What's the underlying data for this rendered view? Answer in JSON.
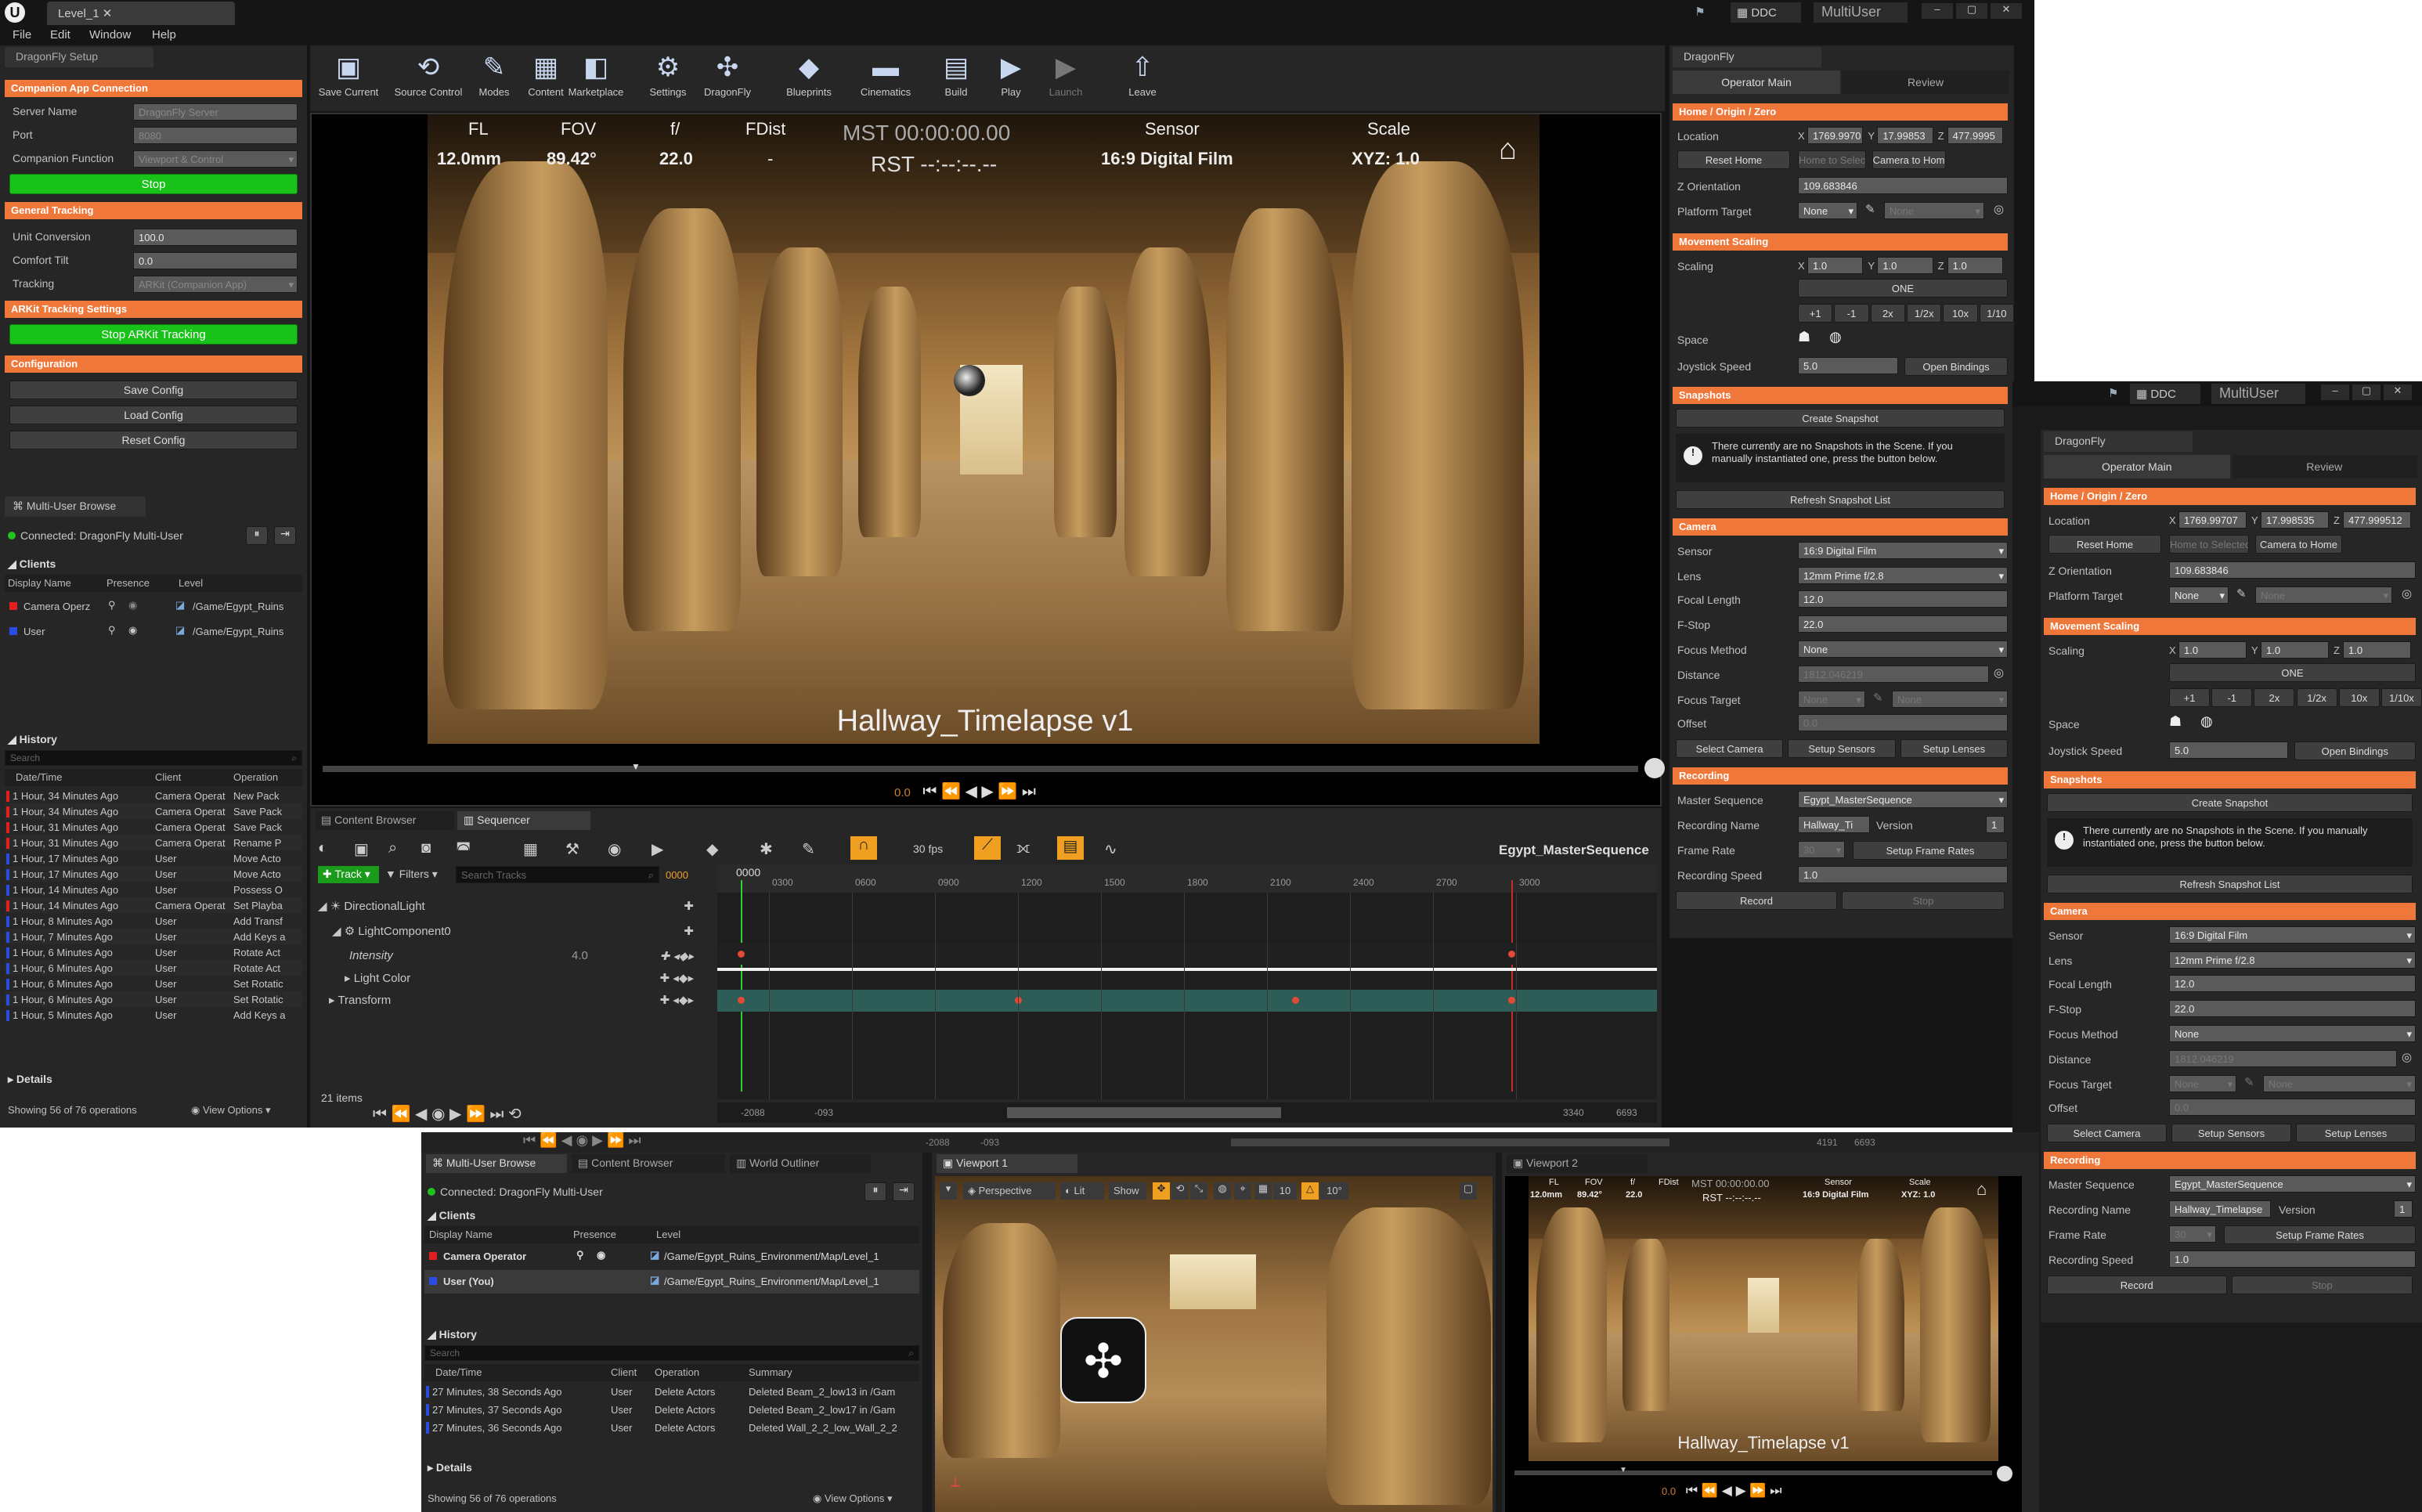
{
  "app": {
    "level_tab": "Level_1",
    "ddc": "DDC",
    "multiuser": "MultiUser",
    "menu": [
      "File",
      "Edit",
      "Window",
      "Help"
    ]
  },
  "left": {
    "tab": "DragonFly Setup",
    "s1": "Companion App Connection",
    "server_name": "Server Name",
    "server_ph": "DragonFly Server",
    "port": "Port",
    "port_val": "8080",
    "cf": "Companion Function",
    "cf_val": "Viewport & Control",
    "stop": "Stop",
    "s2": "General Tracking",
    "uc": "Unit Conversion",
    "uc_val": "100.0",
    "ct": "Comfort Tilt",
    "ct_val": "0.0",
    "tr": "Tracking",
    "tr_val": "ARKit (Companion App)",
    "s3": "ARKit Tracking Settings",
    "stop_arkit": "Stop ARKit Tracking",
    "s4": "Configuration",
    "save": "Save Config",
    "load": "Load Config",
    "reset": "Reset Config"
  },
  "mu": {
    "tab": "Multi-User Browse",
    "connected": "Connected: DragonFly Multi-User",
    "clients": "Clients",
    "cols": [
      "Display Name",
      "Presence",
      "Level"
    ],
    "rows": [
      {
        "name": "Camera Operz",
        "level": "/Game/Egypt_Ruins"
      },
      {
        "name": "User",
        "level": "/Game/Egypt_Ruins"
      }
    ],
    "history": "History",
    "search": "Search",
    "hcols": [
      "Date/Time",
      "Client",
      "Operation"
    ],
    "hrows": [
      [
        "1 Hour, 34 Minutes Ago",
        "Camera Operat",
        "New Pack"
      ],
      [
        "1 Hour, 34 Minutes Ago",
        "Camera Operat",
        "Save Pack"
      ],
      [
        "1 Hour, 31 Minutes Ago",
        "Camera Operat",
        "Save Pack"
      ],
      [
        "1 Hour, 31 Minutes Ago",
        "Camera Operat",
        "Rename P"
      ],
      [
        "1 Hour, 17 Minutes Ago",
        "User",
        "Move Acto"
      ],
      [
        "1 Hour, 17 Minutes Ago",
        "User",
        "Move Acto"
      ],
      [
        "1 Hour, 14 Minutes Ago",
        "User",
        "Possess O"
      ],
      [
        "1 Hour, 14 Minutes Ago",
        "Camera Operat",
        "Set Playba"
      ],
      [
        "1 Hour, 8 Minutes Ago",
        "User",
        "Add Transf"
      ],
      [
        "1 Hour, 7 Minutes Ago",
        "User",
        "Add Keys a"
      ],
      [
        "1 Hour, 6 Minutes Ago",
        "User",
        "Rotate Act"
      ],
      [
        "1 Hour, 6 Minutes Ago",
        "User",
        "Rotate Act"
      ],
      [
        "1 Hour, 6 Minutes Ago",
        "User",
        "Set Rotatic"
      ],
      [
        "1 Hour, 6 Minutes Ago",
        "User",
        "Set Rotatic"
      ],
      [
        "1 Hour, 5 Minutes Ago",
        "User",
        "Add Keys a"
      ]
    ],
    "details": "Details",
    "showing": "Showing 56 of 76 operations",
    "view_options": "View Options"
  },
  "toolbar": [
    "Save Current",
    "Source Control",
    "Modes",
    "Content",
    "Marketplace",
    "Settings",
    "DragonFly",
    "Blueprints",
    "Cinematics",
    "Build",
    "Play",
    "Launch",
    "Leave"
  ],
  "hud": {
    "fl": "FL",
    "fl_v": "12.0mm",
    "fov": "FOV",
    "fov_v": "89.42°",
    "f": "f/",
    "f_v": "22.0",
    "fd": "FDist",
    "fd_v": "-",
    "mst": "MST 00:00:00.00",
    "rst": "RST --:--:--.--",
    "sensor": "Sensor",
    "sensor_v": "16:9 Digital Film",
    "scale": "Scale",
    "scale_v": "XYZ: 1.0",
    "title": "Hallway_Timelapse v1",
    "time": "0.0"
  },
  "seq": {
    "tabs": [
      "Content Browser",
      "Sequencer"
    ],
    "fps": "30 fps",
    "seqname": "Egypt_MasterSequence",
    "track": "Track",
    "filters": "Filters",
    "search": "Search Tracks",
    "frame": "0000",
    "cur": "0000",
    "tracks": [
      "DirectionalLight",
      "LightComponent0",
      "Intensity",
      "Light Color",
      "Transform"
    ],
    "int_val": "4.0",
    "items": "21 items",
    "ticks": [
      "0300",
      "0600",
      "0900",
      "1200",
      "1500",
      "1800",
      "2100",
      "2400",
      "2700",
      "3000"
    ],
    "range": [
      "-2088",
      "-093",
      "3340",
      "6693"
    ]
  },
  "rp": {
    "tab": "DragonFly",
    "t1": "Operator Main",
    "t2": "Review",
    "home": "Home / Origin / Zero",
    "loc": "Location",
    "lx": "1769.9970",
    "ly": "17.99853",
    "lz": "477.9995",
    "reset_home": "Reset Home",
    "home_sel": "Home to Selected",
    "cam_home": "Camera to Home",
    "zo": "Z Orientation",
    "zo_v": "109.683846",
    "pt": "Platform Target",
    "none": "None",
    "ms": "Movement Scaling",
    "scaling": "Scaling",
    "sx": "1.0",
    "one": "ONE",
    "steps": [
      "+1",
      "-1",
      "2x",
      "1/2x",
      "10x",
      "1/10"
    ],
    "space": "Space",
    "js": "Joystick Speed",
    "js_v": "5.0",
    "bind": "Open Bindings",
    "snap": "Snapshots",
    "create": "Create Snapshot",
    "msg": "There currently are no Snapshots in the Scene. If you manually instantiated one, press the button below.",
    "refresh": "Refresh Snapshot List",
    "cam": "Camera",
    "sensor": "Sensor",
    "sensor_v": "16:9 Digital Film",
    "lens": "Lens",
    "lens_v": "12mm Prime f/2.8",
    "flen": "Focal Length",
    "flen_v": "12.0",
    "fstop": "F-Stop",
    "fstop_v": "22.0",
    "fm": "Focus Method",
    "dist": "Distance",
    "dist_v": "1812.046219",
    "ft": "Focus Target",
    "off": "Offset",
    "off_v": "0.0",
    "selcam": "Select Camera",
    "setsens": "Setup Sensors",
    "setlens": "Setup Lenses",
    "rec": "Recording",
    "ms2": "Master Sequence",
    "ms2_v": "Egypt_MasterSequence",
    "rn": "Recording Name",
    "rn_v": "Hallway_Ti",
    "rn_v2": "Hallway_Timelapse",
    "ver": "Version",
    "ver_v": "1",
    "fr": "Frame Rate",
    "fr_v": "30",
    "sfr": "Setup Frame Rates",
    "rs": "Recording Speed",
    "rs_v": "1.0",
    "record": "Record",
    "stop": "Stop"
  },
  "rp2": {
    "lx": "1769.99707",
    "ly": "17.998535",
    "lz": "477.999512",
    "step_last": "1/10x"
  },
  "bot": {
    "tabs": [
      "Multi-User Browse",
      "Content Browser",
      "World Outliner"
    ],
    "connected": "Connected: DragonFly Multi-User",
    "rows": [
      {
        "name": "Camera Operator",
        "level": "/Game/Egypt_Ruins_Environment/Map/Level_1"
      },
      {
        "name": "User (You)",
        "level": "/Game/Egypt_Ruins_Environment/Map/Level_1"
      }
    ],
    "hcols": [
      "Date/Time",
      "Client",
      "Operation",
      "Summary"
    ],
    "hrows": [
      [
        "27 Minutes, 38 Seconds Ago",
        "User",
        "Delete Actors",
        "Deleted Beam_2_low13 in /Gam"
      ],
      [
        "27 Minutes, 37 Seconds Ago",
        "User",
        "Delete Actors",
        "Deleted Beam_2_low17 in /Gam"
      ],
      [
        "27 Minutes, 36 Seconds Ago",
        "User",
        "Delete Actors",
        "Deleted Wall_2_2_low_Wall_2_2"
      ]
    ],
    "vp1": "Viewport 1",
    "vp2": "Viewport 2",
    "persp": "Perspective",
    "lit": "Lit",
    "show": "Show",
    "snap": "10",
    "ang": "10°",
    "range2": [
      "-2088",
      "-093",
      "4191",
      "6693"
    ]
  }
}
